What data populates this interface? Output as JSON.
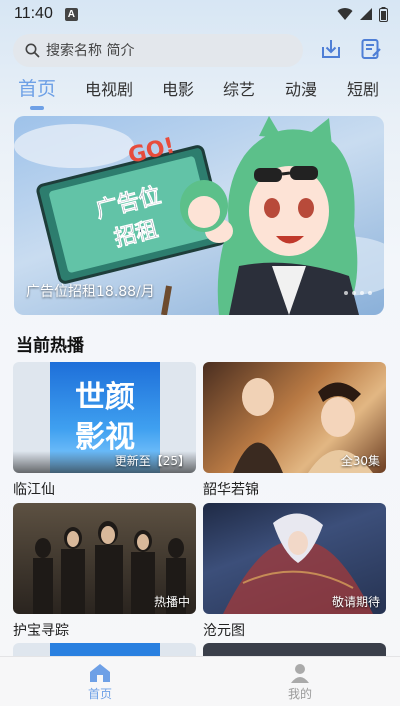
{
  "status": {
    "time": "11:40",
    "notif_letter": "A"
  },
  "search": {
    "placeholder": "搜索名称 简介"
  },
  "tabs": [
    {
      "label": "首页",
      "active": true
    },
    {
      "label": "电视剧"
    },
    {
      "label": "电影"
    },
    {
      "label": "综艺"
    },
    {
      "label": "动漫"
    },
    {
      "label": "短剧"
    }
  ],
  "banner": {
    "caption": "广告位招租18.88/月",
    "sign_text": "广告位招租",
    "sign_text2": "GO!"
  },
  "section": {
    "title": "当前热播"
  },
  "cards": [
    {
      "title": "临江仙",
      "badge": "更新至【25】",
      "poster_text": "世颜影视"
    },
    {
      "title": "韶华若锦",
      "badge": "全30集"
    },
    {
      "title": "护宝寻踪",
      "badge": "热播中"
    },
    {
      "title": "沧元图",
      "badge": "敬请期待"
    }
  ],
  "bottom_nav": [
    {
      "label": "首页",
      "active": true
    },
    {
      "label": "我的"
    }
  ],
  "colors": {
    "accent": "#6ea0e6",
    "inactive": "#9a9a9a"
  }
}
